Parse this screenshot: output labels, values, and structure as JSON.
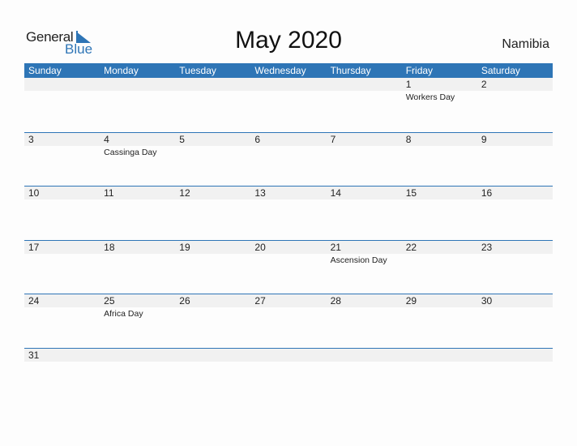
{
  "logo": {
    "text1": "General",
    "text2": "Blue",
    "accent": "#2e75b6"
  },
  "title": "May 2020",
  "country": "Namibia",
  "weekdays": [
    "Sunday",
    "Monday",
    "Tuesday",
    "Wednesday",
    "Thursday",
    "Friday",
    "Saturday"
  ],
  "weeks": [
    [
      {
        "d": ""
      },
      {
        "d": ""
      },
      {
        "d": ""
      },
      {
        "d": ""
      },
      {
        "d": ""
      },
      {
        "d": "1",
        "h": "Workers Day"
      },
      {
        "d": "2"
      }
    ],
    [
      {
        "d": "3"
      },
      {
        "d": "4",
        "h": "Cassinga Day"
      },
      {
        "d": "5"
      },
      {
        "d": "6"
      },
      {
        "d": "7"
      },
      {
        "d": "8"
      },
      {
        "d": "9"
      }
    ],
    [
      {
        "d": "10"
      },
      {
        "d": "11"
      },
      {
        "d": "12"
      },
      {
        "d": "13"
      },
      {
        "d": "14"
      },
      {
        "d": "15"
      },
      {
        "d": "16"
      }
    ],
    [
      {
        "d": "17"
      },
      {
        "d": "18"
      },
      {
        "d": "19"
      },
      {
        "d": "20"
      },
      {
        "d": "21",
        "h": "Ascension Day"
      },
      {
        "d": "22"
      },
      {
        "d": "23"
      }
    ],
    [
      {
        "d": "24"
      },
      {
        "d": "25",
        "h": "Africa Day"
      },
      {
        "d": "26"
      },
      {
        "d": "27"
      },
      {
        "d": "28"
      },
      {
        "d": "29"
      },
      {
        "d": "30"
      }
    ],
    [
      {
        "d": "31"
      },
      {
        "d": ""
      },
      {
        "d": ""
      },
      {
        "d": ""
      },
      {
        "d": ""
      },
      {
        "d": ""
      },
      {
        "d": ""
      }
    ]
  ]
}
